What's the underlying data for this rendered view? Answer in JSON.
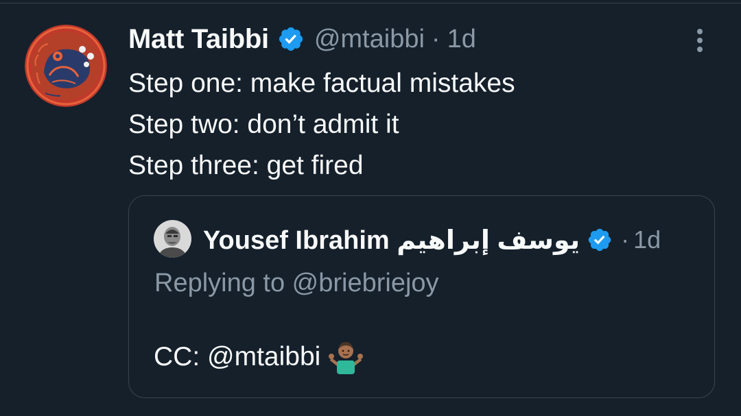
{
  "tweet": {
    "author_name": "Matt Taibbi",
    "handle": "@mtaibbi",
    "separator": "·",
    "time": "1d",
    "lines": [
      "Step one: make factual mistakes",
      "Step two: don’t admit it",
      "Step three: get fired"
    ]
  },
  "quoted": {
    "author_name": "Yousef Ibrahim يوسف إبراهيم",
    "separator": "·",
    "time": "1d",
    "replying_to": "Replying to @briebriejoy",
    "body": "CC: @mtaibbi"
  },
  "icons": {
    "verified": "verified-badge-icon",
    "more": "more-options-icon",
    "emoji": "person-shrugging-emoji"
  },
  "colors": {
    "background": "#15202b",
    "verified_blue": "#1d9bf0",
    "secondary_text": "#8b98a5",
    "border": "#38444d"
  }
}
